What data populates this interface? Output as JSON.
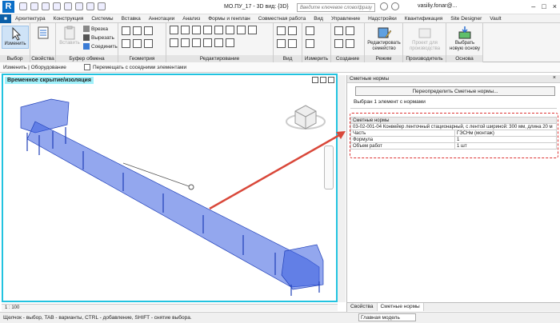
{
  "app": {
    "logo_letter": "R",
    "doc_title": "МО.ПУ_17 - 3D вид: {3D}",
    "search_placeholder": "Введите ключевое слово/фразу",
    "user": "vasiliy.fonar@...",
    "window_controls": [
      "–",
      "□",
      "×"
    ]
  },
  "tabs": [
    {
      "label": "Архитектура"
    },
    {
      "label": "Конструкция"
    },
    {
      "label": "Системы"
    },
    {
      "label": "Вставка"
    },
    {
      "label": "Аннотации"
    },
    {
      "label": "Анализ"
    },
    {
      "label": "Формы и генплан"
    },
    {
      "label": "Совместная работа"
    },
    {
      "label": "Вид"
    },
    {
      "label": "Управление"
    },
    {
      "label": "Надстройки"
    },
    {
      "label": "Квантификация"
    },
    {
      "label": "Site Designer"
    },
    {
      "label": "Vault"
    }
  ],
  "ribbon": {
    "modify_label": "Изменить",
    "insert_label": "Вставить",
    "clipboard": {
      "cut": "Врезка",
      "cut2": "Вырезать",
      "join": "Соединить"
    },
    "panels": [
      "Выбор",
      "Свойства",
      "Буфер обмена",
      "Геометрия",
      "Редактирование",
      "Вид",
      "Измерить",
      "Создание",
      "Режим",
      "Производитель",
      "Основа"
    ],
    "edit_family": "Редактировать семейство",
    "project_for_manufacturing": "Проект для производства",
    "pick_new_host": "Выбрать новую основу"
  },
  "optbar": {
    "context": "Изменить | Оборудование",
    "move_with_nearby": "Перемещать с соседними элементами"
  },
  "viewport": {
    "label": "Временное скрытие/изоляция",
    "scale": "1 : 100"
  },
  "properties": {
    "header": "Сметные нормы",
    "override_button": "Переопределить Сметные нормы...",
    "selected": "Выбран 1 элемент с нормами",
    "group": "Сметные нормы",
    "rows": [
      {
        "name": "03-02-001-04 Конвейер ленточный стационарный, с лентой шириной: 300 мм, длина 20 м",
        "value": ""
      },
      {
        "name": "Часть",
        "value": "ГЭСНм (монтаж)"
      },
      {
        "name": "Формула",
        "value": "1"
      },
      {
        "name": "Объем работ",
        "value": "1 шт"
      }
    ],
    "bottom_tabs": [
      "Свойства",
      "Сметные нормы"
    ]
  },
  "status": {
    "hint": "Щелчок - выбор, TAB - варианты, CTRL - добавление, SHIFT - снятие выбора.",
    "model": "Главная модель"
  },
  "colors": {
    "viewport_border": "#22c3e0",
    "highlight": "#d33333",
    "arrow": "#d9483a",
    "conveyor": "#2a52d6"
  }
}
